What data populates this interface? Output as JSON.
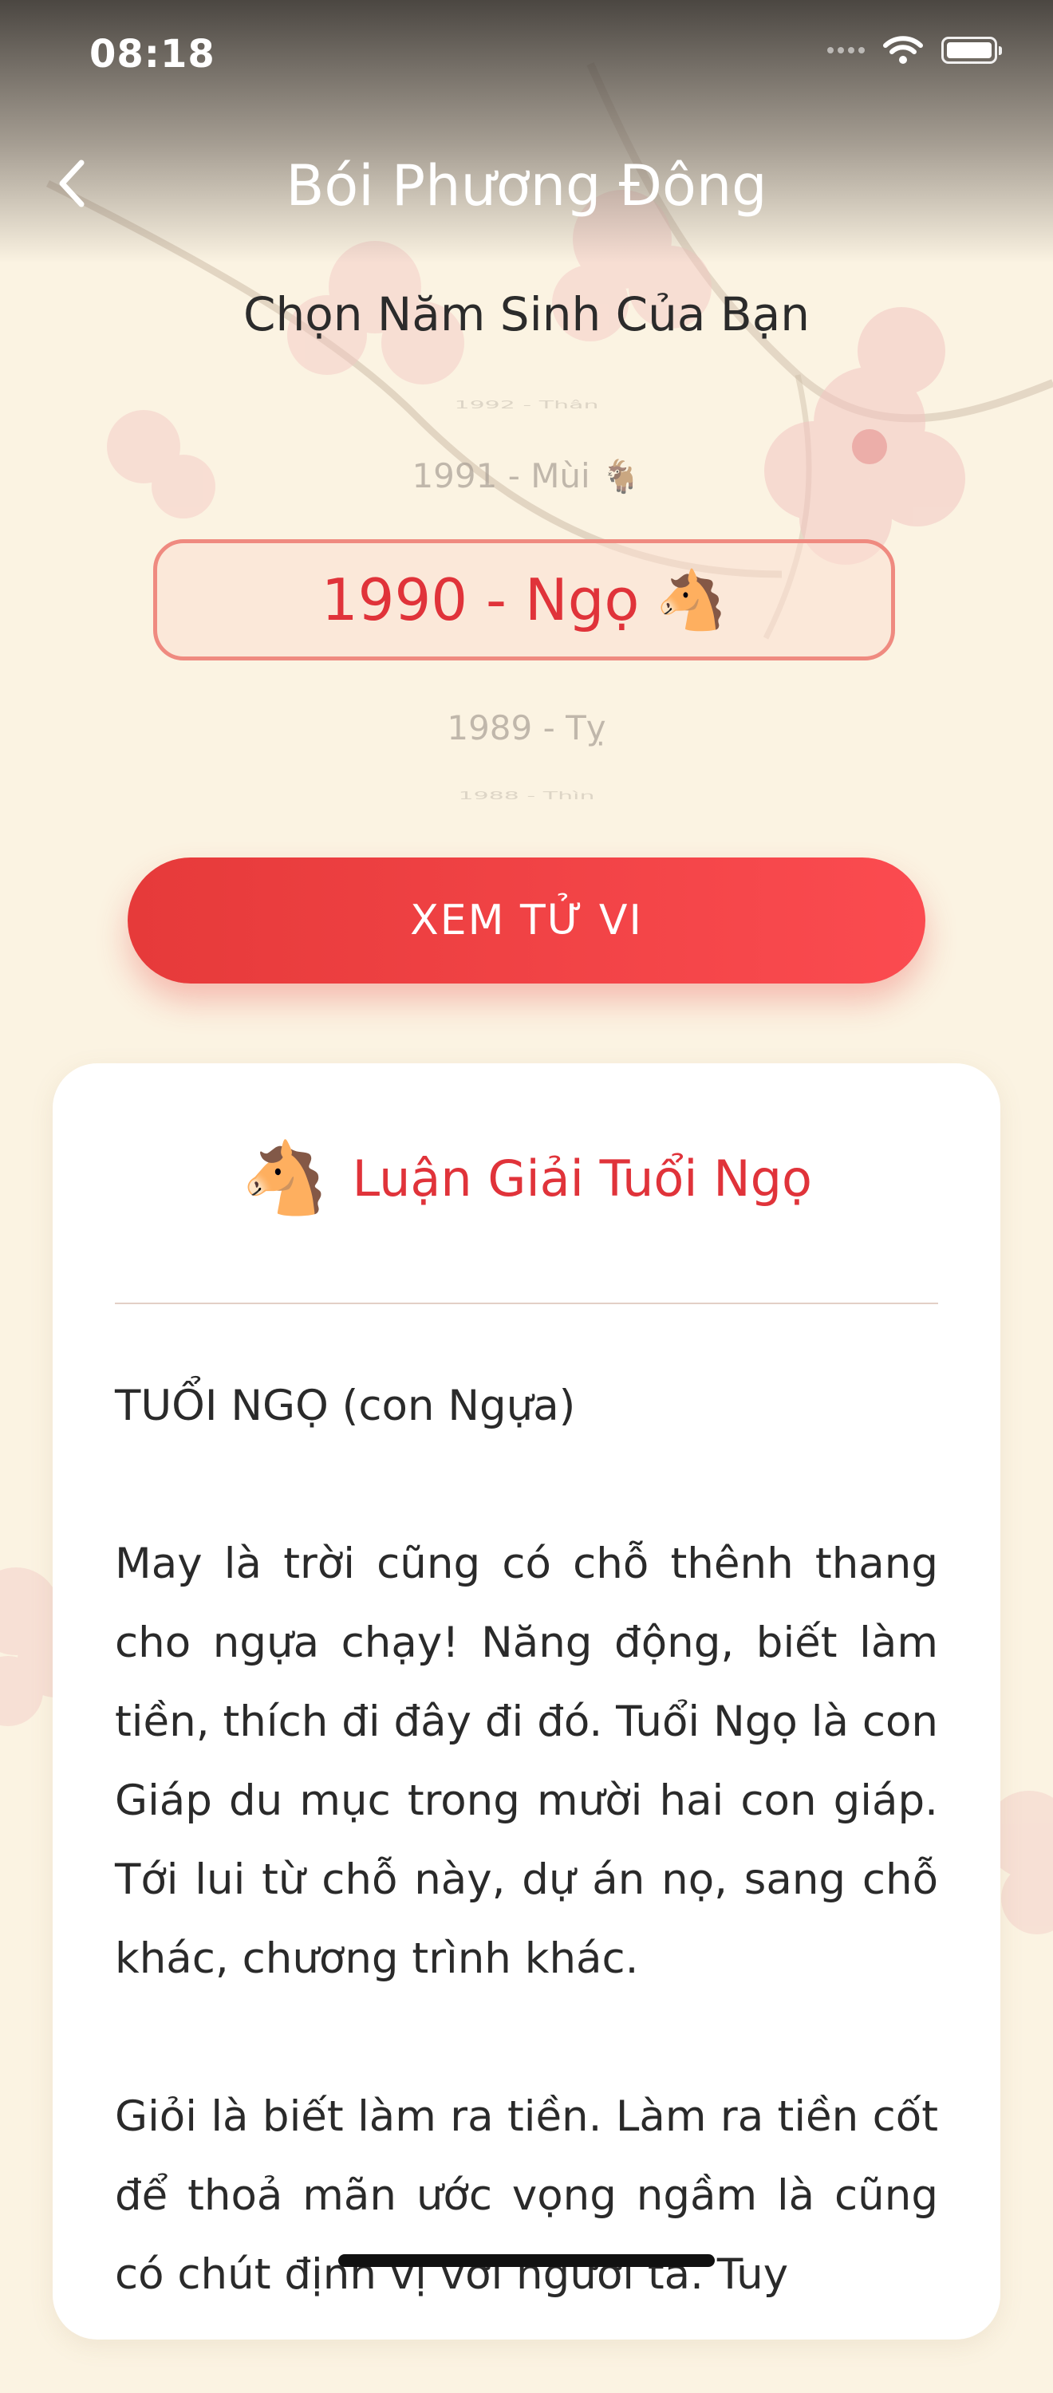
{
  "status_bar": {
    "time": "08:18"
  },
  "nav": {
    "title": "Bói Phương Đông"
  },
  "picker": {
    "heading": "Chọn Năm Sinh Của Bạn",
    "years": [
      {
        "label": "1992 - Thân",
        "emoji": ""
      },
      {
        "label": "1991 - Mùi",
        "emoji": "🐐"
      },
      {
        "label": "1990 - Ngọ",
        "emoji": "🐴"
      },
      {
        "label": "1989 - Tỵ",
        "emoji": ""
      },
      {
        "label": "1988 - Thìn",
        "emoji": ""
      }
    ],
    "selected_index": 2
  },
  "cta": {
    "label": "XEM TỬ VI"
  },
  "card": {
    "title_emoji": "🐴",
    "title": "Luận Giải Tuổi Ngọ",
    "paragraphs": [
      "TUỔI NGỌ (con Ngựa)",
      "May là trời cũng có chỗ thênh thang cho ngựa chạy! Năng động, biết làm tiền, thích đi đây đi đó. Tuổi Ngọ là con Giáp du mục trong mười hai con giáp. Tới lui từ chỗ này, dự án nọ, sang chỗ khác, chương trình khác.",
      "Giỏi là biết làm ra tiền. Làm ra tiền cốt để thoả mãn ước vọng ngầm là cũng có chút định vị với người ta. Tuy"
    ]
  },
  "colors": {
    "accent": "#e0333a",
    "cta_start": "#e63a3a",
    "cta_end": "#fb4b50",
    "background": "#fbf3e2"
  }
}
